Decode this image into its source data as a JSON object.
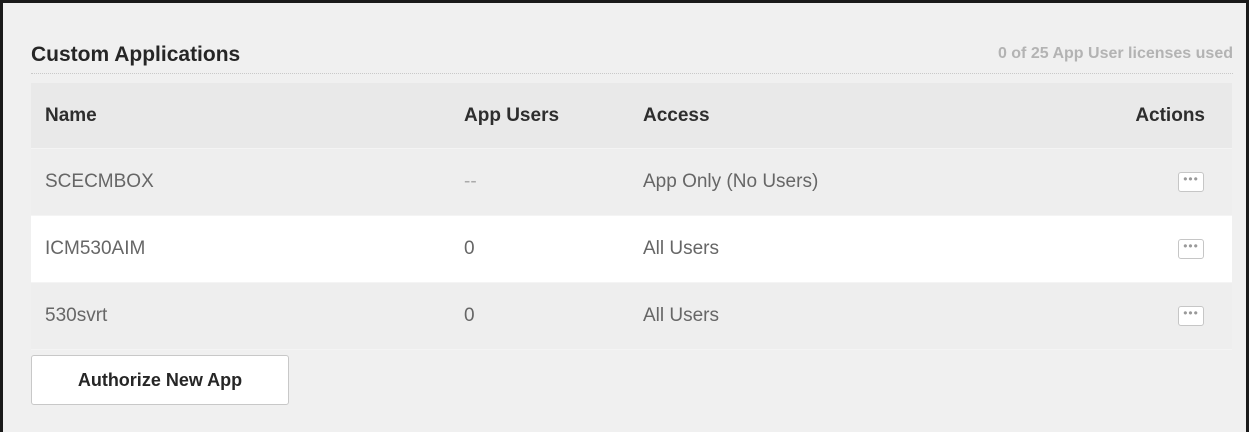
{
  "header": {
    "title": "Custom Applications",
    "licenses": "0 of 25 App User licenses used"
  },
  "table": {
    "columns": [
      "Name",
      "App Users",
      "Access",
      "Actions"
    ],
    "rows": [
      {
        "name": "SCECMBOX",
        "app_users": "--",
        "access": "App Only (No Users)",
        "actions": "more-options-icon"
      },
      {
        "name": "ICM530AIM",
        "app_users": "0",
        "access": "All Users",
        "actions": "more-options-icon"
      },
      {
        "name": "530svrt",
        "app_users": "0",
        "access": "All Users",
        "actions": "more-options-icon"
      }
    ]
  },
  "buttons": {
    "authorize": "Authorize New App"
  },
  "colors": {
    "background": "#f0f0f0",
    "row_alt": "#ffffff",
    "muted_text": "#b3b3b3"
  }
}
